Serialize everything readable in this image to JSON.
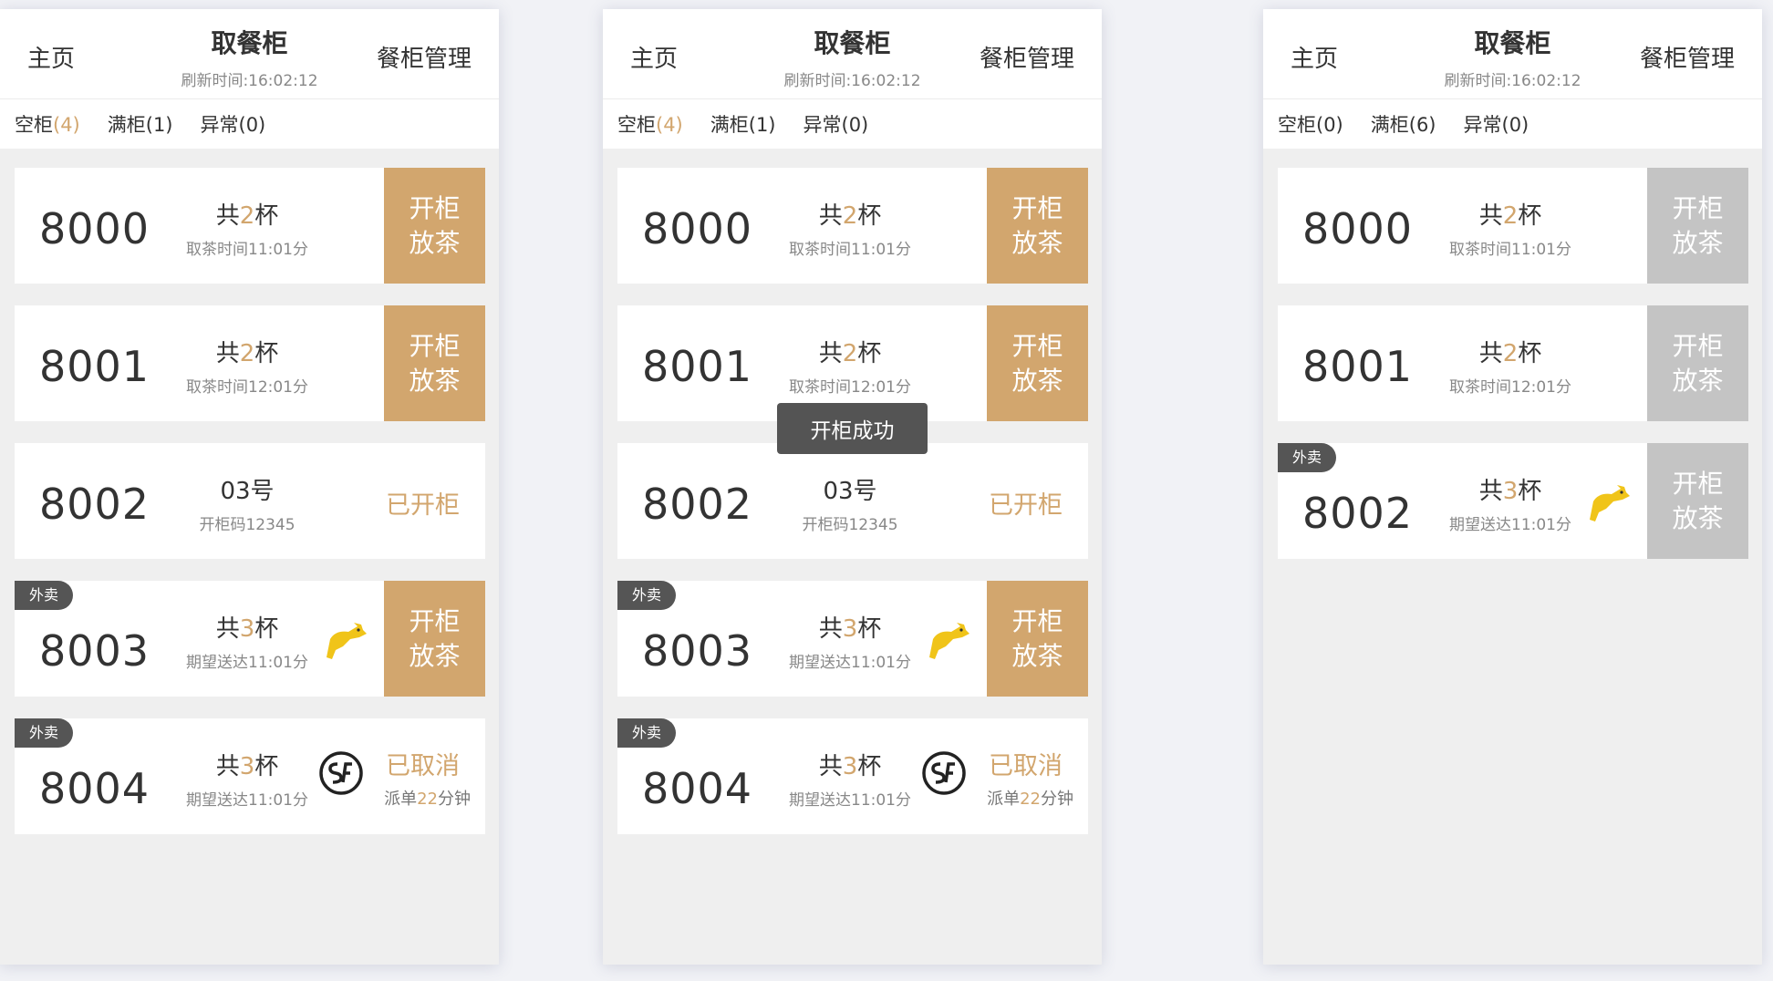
{
  "screens": [
    {
      "header": {
        "home": "主页",
        "title": "取餐柜",
        "refresh": "刷新时间:16:02:12",
        "manage": "餐柜管理"
      },
      "filters": [
        {
          "label": "空柜",
          "count": "(4)"
        },
        {
          "label": "满柜",
          "count": "(1)"
        },
        {
          "label": "异常",
          "count": "(0)"
        }
      ],
      "cards": [
        {
          "number": "8000",
          "main_prefix": "共",
          "count": "2",
          "main_suffix": "杯",
          "sub": "取茶时间11:01分",
          "action_line1": "开柜",
          "action_line2": "放茶"
        },
        {
          "number": "8001",
          "main_prefix": "共",
          "count": "2",
          "main_suffix": "杯",
          "sub": "取茶时间12:01分",
          "action_line1": "开柜",
          "action_line2": "放茶"
        },
        {
          "number": "8002",
          "main": "03号",
          "sub": "开柜码12345",
          "status": "已开柜"
        },
        {
          "tag": "外卖",
          "number": "8003",
          "main_prefix": "共",
          "count": "3",
          "main_suffix": "杯",
          "sub": "期望送达11:01分",
          "courier": "kangaroo-courier-icon",
          "action_line1": "开柜",
          "action_line2": "放茶"
        },
        {
          "tag": "外卖",
          "number": "8004",
          "main_prefix": "共",
          "count": "3",
          "main_suffix": "杯",
          "sub": "期望送达11:01分",
          "courier": "sf-express-icon",
          "status": "已取消",
          "status_sub_prefix": "派单",
          "status_sub_count": "22",
          "status_sub_suffix": "分钟"
        }
      ]
    },
    {
      "header": {
        "home": "主页",
        "title": "取餐柜",
        "refresh": "刷新时间:16:02:12",
        "manage": "餐柜管理"
      },
      "filters": [
        {
          "label": "空柜",
          "count": "(4)"
        },
        {
          "label": "满柜",
          "count": "(1)"
        },
        {
          "label": "异常",
          "count": "(0)"
        }
      ],
      "toast": "开柜成功",
      "cards": [
        {
          "number": "8000",
          "main_prefix": "共",
          "count": "2",
          "main_suffix": "杯",
          "sub": "取茶时间11:01分",
          "action_line1": "开柜",
          "action_line2": "放茶"
        },
        {
          "number": "8001",
          "main_prefix": "共",
          "count": "2",
          "main_suffix": "杯",
          "sub": "取茶时间12:01分",
          "action_line1": "开柜",
          "action_line2": "放茶"
        },
        {
          "number": "8002",
          "main": "03号",
          "sub": "开柜码12345",
          "status": "已开柜"
        },
        {
          "tag": "外卖",
          "number": "8003",
          "main_prefix": "共",
          "count": "3",
          "main_suffix": "杯",
          "sub": "期望送达11:01分",
          "courier": "kangaroo-courier-icon",
          "action_line1": "开柜",
          "action_line2": "放茶"
        },
        {
          "tag": "外卖",
          "number": "8004",
          "main_prefix": "共",
          "count": "3",
          "main_suffix": "杯",
          "sub": "期望送达11:01分",
          "courier": "sf-express-icon",
          "status": "已取消",
          "status_sub_prefix": "派单",
          "status_sub_count": "22",
          "status_sub_suffix": "分钟"
        }
      ]
    },
    {
      "header": {
        "home": "主页",
        "title": "取餐柜",
        "refresh": "刷新时间:16:02:12",
        "manage": "餐柜管理"
      },
      "filters": [
        {
          "label": "空柜",
          "count": "(0)"
        },
        {
          "label": "满柜",
          "count": "(6)"
        },
        {
          "label": "异常",
          "count": "(0)"
        }
      ],
      "cards": [
        {
          "number": "8000",
          "main_prefix": "共",
          "count": "2",
          "main_suffix": "杯",
          "sub": "取茶时间11:01分",
          "action_line1": "开柜",
          "action_line2": "放茶"
        },
        {
          "number": "8001",
          "main_prefix": "共",
          "count": "2",
          "main_suffix": "杯",
          "sub": "取茶时间12:01分",
          "action_line1": "开柜",
          "action_line2": "放茶"
        },
        {
          "tag": "外卖",
          "number": "8002",
          "main_prefix": "共",
          "count": "3",
          "main_suffix": "杯",
          "sub": "期望送达11:01分",
          "courier": "kangaroo-courier-icon",
          "action_line1": "开柜",
          "action_line2": "放茶"
        }
      ]
    }
  ],
  "colors": {
    "accent": "#d2a66e",
    "disabled": "#c4c4c4",
    "tag_bg": "#555555",
    "toast_bg": "#545454"
  }
}
